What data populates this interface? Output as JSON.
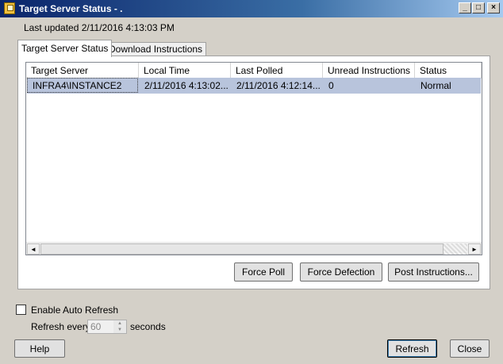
{
  "window": {
    "title": "Target Server Status - .",
    "min_glyph": "_",
    "max_glyph": "□",
    "close_glyph": "×"
  },
  "last_updated": "Last updated 2/11/2016 4:13:03 PM",
  "tabs": [
    {
      "label": "Target Server Status",
      "active": true
    },
    {
      "label": "Download Instructions",
      "active": false
    }
  ],
  "table": {
    "columns": [
      "Target Server",
      "Local Time",
      "Last Polled",
      "Unread Instructions",
      "Status"
    ],
    "rows": [
      [
        "INFRA4\\INSTANCE2",
        "2/11/2016 4:13:02...",
        "2/11/2016 4:12:14...",
        "0",
        "Normal"
      ]
    ]
  },
  "scroll": {
    "left": "◄",
    "right": "►"
  },
  "buttons": {
    "force_poll": "Force Poll",
    "force_defection": "Force Defection",
    "post_instructions": "Post Instructions...",
    "help": "Help",
    "refresh": "Refresh",
    "close": "Close"
  },
  "auto_refresh": {
    "label": "Enable Auto Refresh",
    "checked": false,
    "refresh_every": "Refresh every",
    "value": "60",
    "unit": "seconds",
    "spin_up": "▲",
    "spin_down": "▼"
  },
  "colors": {
    "selection": "#b8c4dc",
    "titlebar": "#0a246a"
  }
}
